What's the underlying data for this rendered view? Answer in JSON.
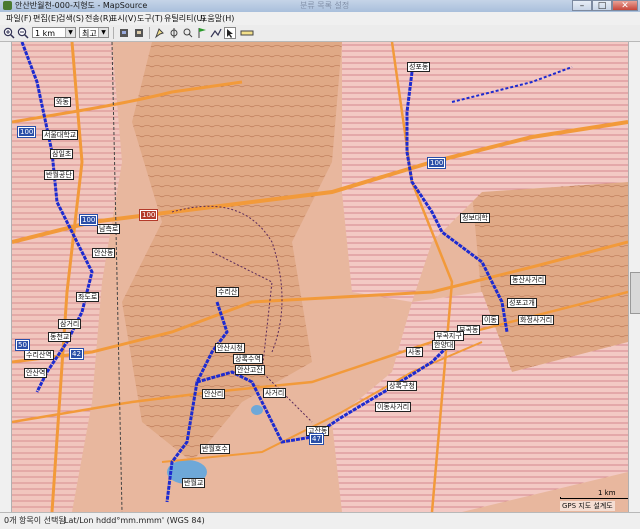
{
  "window": {
    "title": "안산반월천-000-지형도 - MapSource",
    "ghost_title": "분류 목록 설정",
    "min_label": "–",
    "max_label": "□",
    "close_label": "✕"
  },
  "menu": [
    "파일(F)",
    "편집(E)",
    "검색(S)",
    "전송(R)",
    "표시(V)",
    "도구(T)",
    "유틸리티(U)",
    "도움말(H)"
  ],
  "toolbar": {
    "zoom_in_icon": "zoom-in-icon",
    "zoom_out_icon": "zoom-out-icon",
    "zoom_level": "1 km",
    "detail_level": "최고",
    "tools": [
      "receive-icon",
      "send-icon",
      "select-icon",
      "hand-icon",
      "zoom-tool-icon",
      "waypoint-icon",
      "route-icon",
      "track-icon",
      "pointer-icon",
      "measure-icon"
    ]
  },
  "map": {
    "colors": {
      "terrain": "#e8b79e",
      "urban": "#f3c9c4",
      "road_major": "#f29a3a",
      "route": "#1d2bd0",
      "water": "#6ea8d8"
    },
    "places": [
      "성포동",
      "와동",
      "서울대학교",
      "삼일초",
      "반월공단",
      "정보대학",
      "남측로",
      "동산사거리",
      "안산동",
      "성포고개",
      "좌도로",
      "이동",
      "삼거리",
      "화정사거리",
      "동천교",
      "수리산",
      "수리산역",
      "부곡동",
      "안산역",
      "부곡지구",
      "안산시청",
      "한양대",
      "상록수역",
      "사동",
      "안산고잔",
      "상록구청",
      "사거리",
      "이동사거리",
      "안산리",
      "고잔동",
      "반월호수",
      "반월교"
    ],
    "highways": [
      "100",
      "100",
      "100",
      "100",
      "50",
      "42",
      "47"
    ],
    "scale_label": "1 km",
    "credit": "GPS 지도 설계도"
  },
  "status": {
    "selection": "0개 항목이 선택됨",
    "coords": "Lat/Lon hddd°mm.mmm' (WGS 84)"
  }
}
